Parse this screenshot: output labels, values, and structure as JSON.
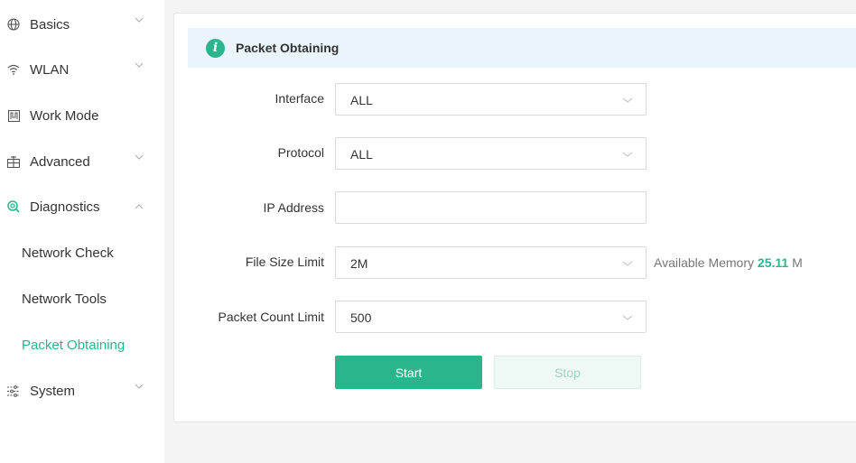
{
  "sidebar": {
    "items": [
      {
        "label": "Basics",
        "icon": "globe-icon",
        "chevron": "down"
      },
      {
        "label": "WLAN",
        "icon": "wifi-icon",
        "chevron": "down"
      },
      {
        "label": "Work Mode",
        "icon": "work-mode-icon"
      },
      {
        "label": "Advanced",
        "icon": "advanced-icon",
        "chevron": "down"
      },
      {
        "label": "Diagnostics",
        "icon": "diagnostics-icon",
        "chevron": "up"
      }
    ],
    "subitems": [
      {
        "label": "Network Check"
      },
      {
        "label": "Network Tools"
      },
      {
        "label": "Packet Obtaining",
        "active": true
      }
    ],
    "system": {
      "label": "System",
      "icon": "system-icon",
      "chevron": "down"
    }
  },
  "banner": {
    "title": "Packet Obtaining",
    "icon": "info-icon"
  },
  "form": {
    "interface": {
      "label": "Interface",
      "value": "ALL"
    },
    "protocol": {
      "label": "Protocol",
      "value": "ALL"
    },
    "ip": {
      "label": "IP Address",
      "value": "",
      "placeholder": ""
    },
    "file_size": {
      "label": "File Size Limit",
      "value": "2M"
    },
    "packet_count": {
      "label": "Packet Count Limit",
      "value": "500"
    }
  },
  "memory": {
    "label": "Available Memory",
    "value": "25.11",
    "unit": "M"
  },
  "buttons": {
    "start": "Start",
    "stop": "Stop"
  },
  "colors": {
    "accent": "#2bb58c",
    "banner_bg": "#eaf5fb",
    "page_bg": "#f4f4f4"
  }
}
